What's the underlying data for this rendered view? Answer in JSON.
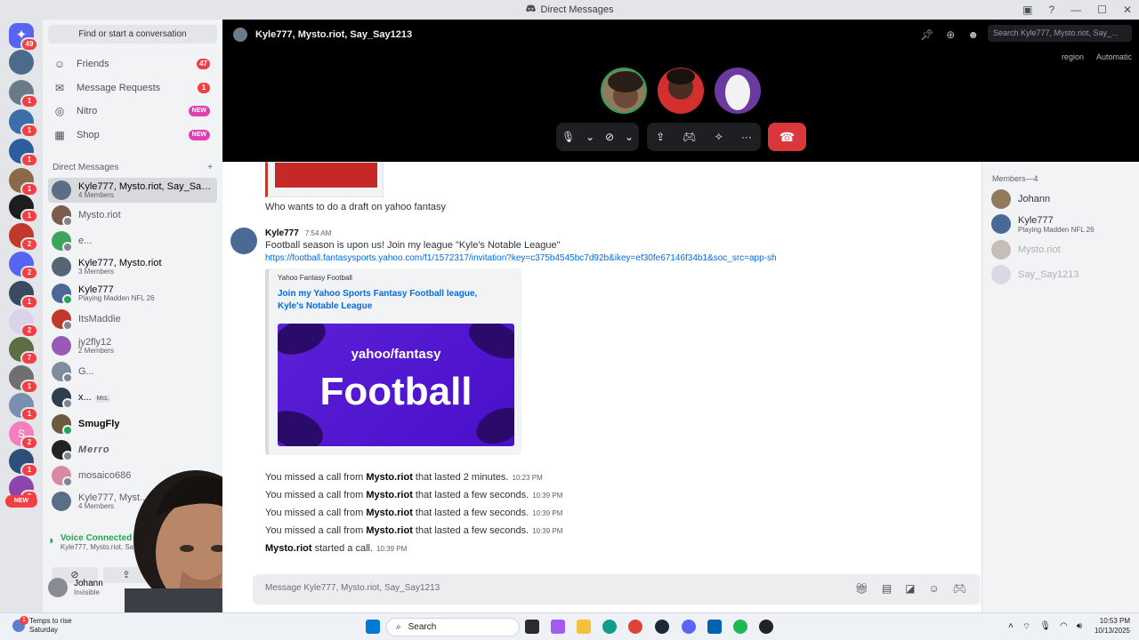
{
  "window": {
    "title": "Direct Messages"
  },
  "server_rail": {
    "home_badge": "49",
    "badges": [
      "1",
      "1",
      "1",
      "1",
      "1",
      "2",
      "2",
      "1",
      "2",
      "7",
      "1",
      "1",
      "2",
      "1",
      "3",
      "1"
    ],
    "new_label": "NEW"
  },
  "sidebar": {
    "search_placeholder": "Find or start a conversation",
    "nav": [
      {
        "label": "Friends",
        "badge": "47"
      },
      {
        "label": "Message Requests",
        "badge": "1"
      },
      {
        "label": "Nitro",
        "badge": "NEW"
      },
      {
        "label": "Shop",
        "badge": "NEW"
      }
    ],
    "dm_header": "Direct Messages",
    "dm_add": "+",
    "dms": [
      {
        "name": "Kyle777, Mysto.riot, Say_Say1...",
        "sub": "4 Members"
      },
      {
        "name": "Mysto.riot",
        "sub": ""
      },
      {
        "name": "e...",
        "sub": ""
      },
      {
        "name": "Kyle777, Mysto.riot",
        "sub": "3 Members"
      },
      {
        "name": "Kyle777",
        "sub": "Playing Madden NFL 26"
      },
      {
        "name": "ItsMaddie",
        "sub": ""
      },
      {
        "name": "jy2fly12",
        "sub": "2 Members"
      },
      {
        "name": "G...",
        "sub": ""
      },
      {
        "name": "x...",
        "sub": "",
        "tag": "McL"
      },
      {
        "name": "SmugFly",
        "sub": ""
      },
      {
        "name": "Merro",
        "sub": ""
      },
      {
        "name": "mosaico686",
        "sub": ""
      },
      {
        "name": "Kyle777, Myst...",
        "sub": "4 Members"
      }
    ],
    "voice": {
      "status": "Voice Connected",
      "channel": "Kyle777, Mysto.riot, Say..."
    },
    "user": {
      "name": "Johann",
      "status": "Invisible"
    }
  },
  "call": {
    "title": "Kyle777, Mysto.riot, Say_Say1213",
    "search_placeholder": "Search Kyle777, Mysto.riot, Say_...",
    "region_label": "region",
    "region_value": "Automatic"
  },
  "chat": {
    "msg1": "Who wants to do a draft on yahoo fantasy",
    "msg2_author": "Kyle777",
    "msg2_time": "7:54 AM",
    "msg2_text": "Football season is upon us! Join my league \"Kyle's Notable League\"",
    "msg2_link": "https://football.fantasysports.yahoo.com/f1/1572317/invitation?key=c375b4545bc7d92b&ikey=ef30fe67146f34b1&soc_src=app-sh",
    "embed": {
      "provider": "Yahoo Fantasy Football",
      "title": "Join my Yahoo Sports Fantasy Football league, Kyle's Notable League",
      "img_brand": "yahoo/fantasy",
      "img_word": "Football"
    },
    "system": [
      {
        "pre": "You missed a call from ",
        "name": "Mysto.riot",
        "post": " that lasted 2 minutes.",
        "time": "10:23 PM"
      },
      {
        "pre": "You missed a call from ",
        "name": "Mysto.riot",
        "post": " that lasted a few seconds.",
        "time": "10:39 PM"
      },
      {
        "pre": "You missed a call from ",
        "name": "Mysto.riot",
        "post": " that lasted a few seconds.",
        "time": "10:39 PM"
      },
      {
        "pre": "You missed a call from ",
        "name": "Mysto.riot",
        "post": " that lasted a few seconds.",
        "time": "10:39 PM"
      },
      {
        "pre": "",
        "name": "Mysto.riot",
        "post": " started a call.",
        "time": "10:39 PM"
      }
    ],
    "compose_placeholder": "Message Kyle777, Mysto.riot, Say_Say1213"
  },
  "members": {
    "header": "Members—4",
    "list": [
      {
        "name": "Johann",
        "sub": ""
      },
      {
        "name": "Kyle777",
        "sub": "Playing Madden NFL 26"
      },
      {
        "name": "Mysto.riot",
        "sub": ""
      },
      {
        "name": "Say_Say1213",
        "sub": ""
      }
    ]
  },
  "taskbar": {
    "weather_title": "Temps to rise",
    "weather_sub": "Saturday",
    "weather_badge": "1",
    "search": "Search",
    "time": "10:53 PM",
    "date": "10/13/2025"
  },
  "colors": {
    "accent": "#5865f2",
    "danger": "#da373c",
    "online": "#23a55a",
    "link": "#006ce7"
  }
}
